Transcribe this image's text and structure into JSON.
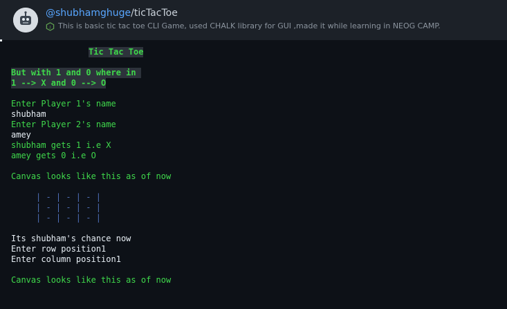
{
  "header": {
    "owner": "@shubhamghuge",
    "separator": "/",
    "repo": "ticTacToe",
    "language_icon": "nodejs-icon",
    "description": "This is basic tic tac toe CLI Game, used CHALK library for GUI ,made it while learning in NEOG CAMP."
  },
  "terminal": {
    "title": "Tic Tac Toe",
    "subtitle_1": "But with 1 and 0 where in ",
    "subtitle_2": "1 --> X and 0 --> O",
    "prompt_p1": "Enter Player 1's name",
    "input_p1": "shubham",
    "prompt_p2": "Enter Player 2's name",
    "input_p2": "amey",
    "assign_p1": "shubham gets 1 i.e X",
    "assign_p2": "amey gets 0 i.e O",
    "canvas_msg_1": "Canvas looks like this as of now",
    "board": [
      "| - | - | - |",
      "| - | - | - |",
      "| - | - | - |"
    ],
    "turn_msg": "Its shubham's chance now",
    "row_prompt": "Enter row position1",
    "col_prompt": "Enter column position1",
    "canvas_msg_2": "Canvas looks like this as of now"
  },
  "colors": {
    "accent_green": "#3fd84b",
    "link_blue": "#58a6ff",
    "board_blue": "#4f6fb8",
    "background": "#0d1117"
  }
}
